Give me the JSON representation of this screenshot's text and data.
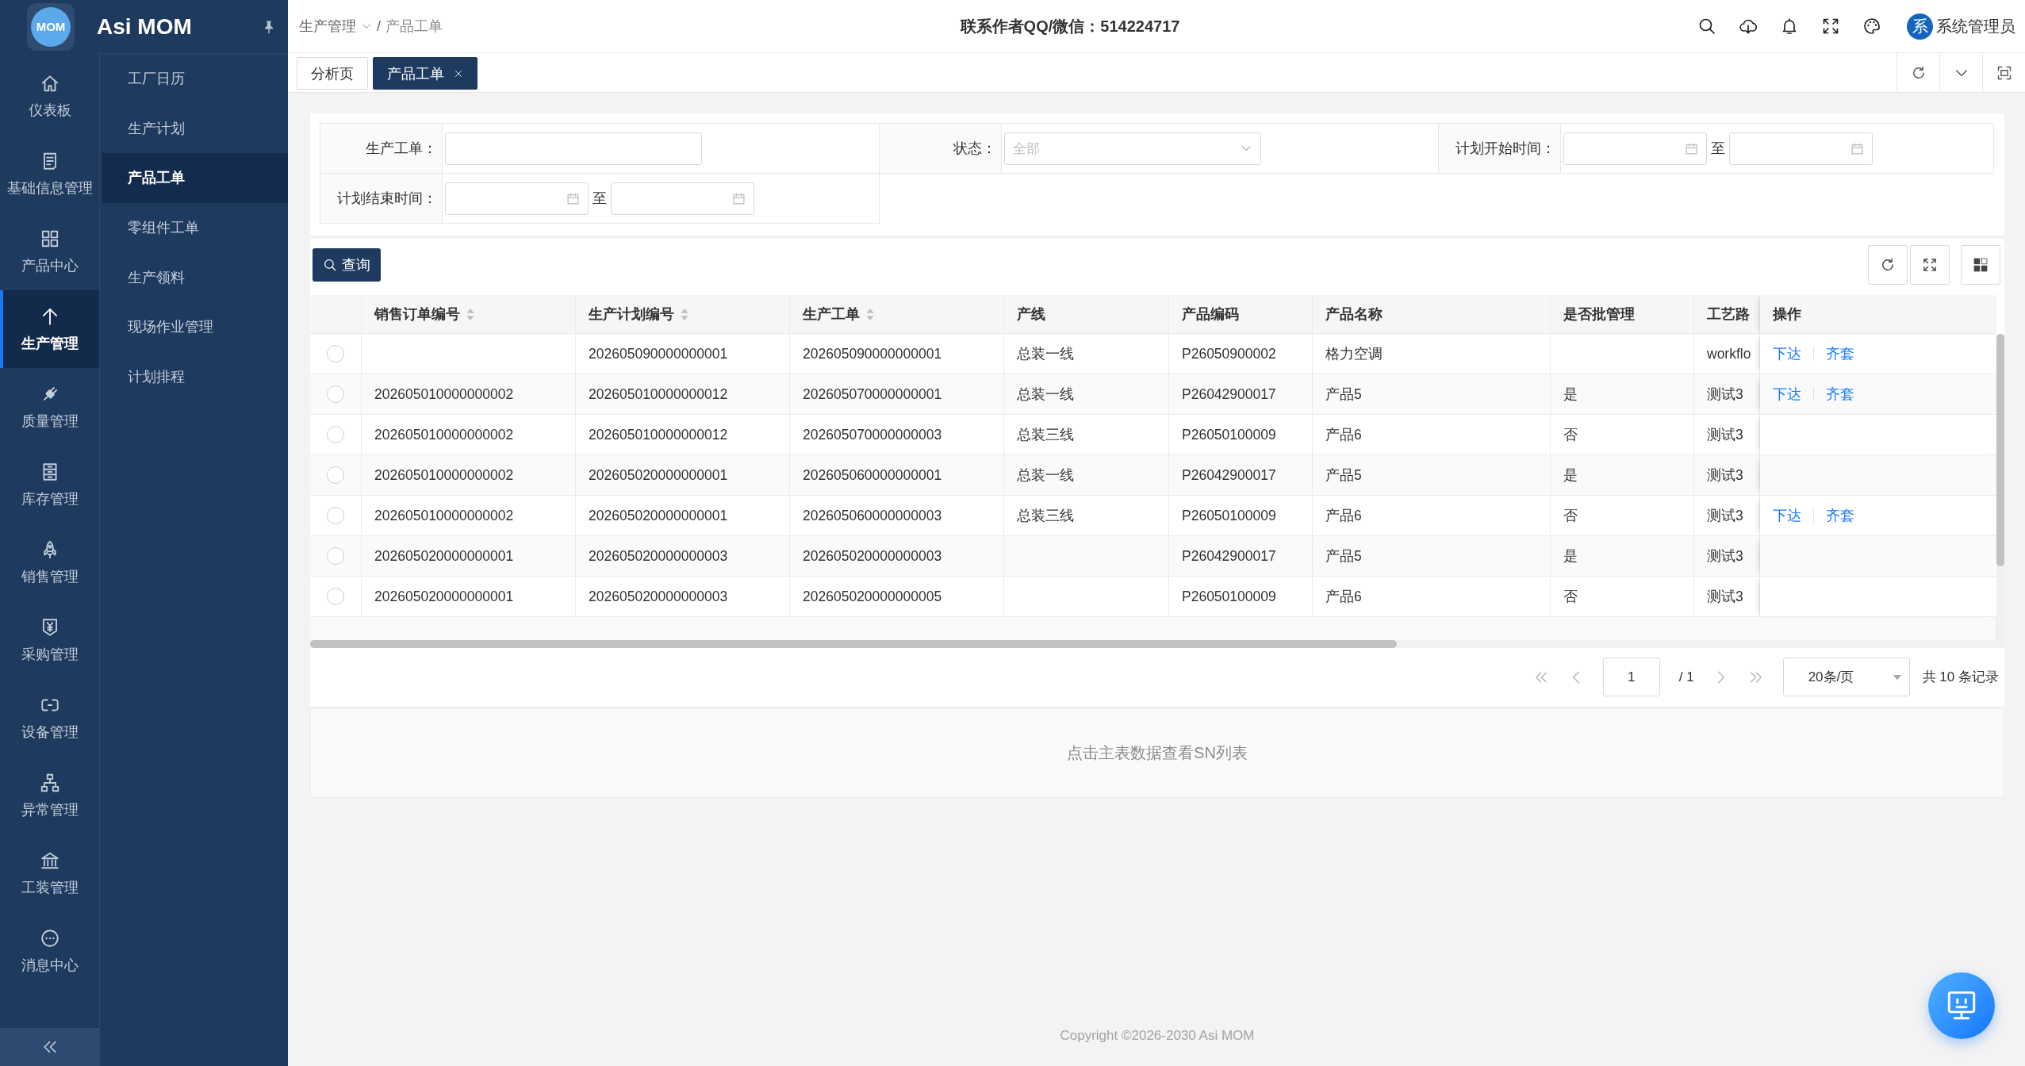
{
  "sidebar": {
    "logo_text": "MOM",
    "title": "Asi MOM",
    "items": [
      {
        "label": "仪表板",
        "selected": false
      },
      {
        "label": "基础信息管理",
        "selected": false
      },
      {
        "label": "产品中心",
        "selected": false
      },
      {
        "label": "生产管理",
        "selected": true
      },
      {
        "label": "质量管理",
        "selected": false
      },
      {
        "label": "库存管理",
        "selected": false
      },
      {
        "label": "销售管理",
        "selected": false
      },
      {
        "label": "采购管理",
        "selected": false
      },
      {
        "label": "设备管理",
        "selected": false
      },
      {
        "label": "异常管理",
        "selected": false
      },
      {
        "label": "工装管理",
        "selected": false
      },
      {
        "label": "消息中心",
        "selected": false
      }
    ]
  },
  "submenu": {
    "items": [
      {
        "label": "工厂日历",
        "selected": false
      },
      {
        "label": "生产计划",
        "selected": false
      },
      {
        "label": "产品工单",
        "selected": true
      },
      {
        "label": "零组件工单",
        "selected": false
      },
      {
        "label": "生产领料",
        "selected": false
      },
      {
        "label": "现场作业管理",
        "selected": false
      },
      {
        "label": "计划排程",
        "selected": false
      }
    ]
  },
  "header": {
    "breadcrumb": [
      {
        "label": "生产管理",
        "dropdown": true
      },
      {
        "label": "产品工单",
        "dropdown": false
      }
    ],
    "breadcrumb_separator": "/",
    "contact": "联系作者QQ/微信：514224717",
    "user": {
      "avatar": "系",
      "name": "系统管理员"
    }
  },
  "tabs": [
    {
      "label": "分析页",
      "selected": false,
      "closable": false
    },
    {
      "label": "产品工单",
      "selected": true,
      "closable": true
    }
  ],
  "filters": [
    {
      "kind": "text",
      "label": "生产工单："
    },
    {
      "kind": "select",
      "label": "状态：",
      "placeholder": "全部"
    },
    {
      "kind": "date_range",
      "label": "计划开始时间：",
      "separator": "至"
    },
    {
      "kind": "date_range",
      "label": "计划结束时间：",
      "separator": "至"
    }
  ],
  "query_button": "查询",
  "table": {
    "columns": [
      {
        "label": "销售订单编号",
        "sortable": true
      },
      {
        "label": "生产计划编号",
        "sortable": true
      },
      {
        "label": "生产工单",
        "sortable": true
      },
      {
        "label": "产线",
        "sortable": false
      },
      {
        "label": "产品编码",
        "sortable": false
      },
      {
        "label": "产品名称",
        "sortable": false
      },
      {
        "label": "是否批管理",
        "sortable": false
      },
      {
        "label": "工艺路",
        "sortable": false
      },
      {
        "label": "操作",
        "sortable": false
      }
    ],
    "rows": [
      {
        "selected": false,
        "production_plan": "202605090000000001",
        "work_order": "202605090000000001",
        "line": "总装一线",
        "product_code": "P26050900002",
        "product_name": "格力空调",
        "column_8": "workflo",
        "actions": [
          "下达",
          "齐套"
        ]
      },
      {
        "selected": false,
        "sales_order": "202605010000000002",
        "production_plan": "202605010000000012",
        "work_order": "202605070000000001",
        "line": "总装一线",
        "product_code": "P26042900017",
        "product_name": "产品5",
        "batch_managed": "是",
        "column_8": "测试3",
        "actions": [
          "下达",
          "齐套"
        ]
      },
      {
        "selected": false,
        "sales_order": "202605010000000002",
        "production_plan": "202605010000000012",
        "work_order": "202605070000000003",
        "line": "总装三线",
        "product_code": "P26050100009",
        "product_name": "产品6",
        "batch_managed": "否",
        "column_8": "测试3"
      },
      {
        "selected": false,
        "sales_order": "202605010000000002",
        "production_plan": "202605020000000001",
        "work_order": "202605060000000001",
        "line": "总装一线",
        "product_code": "P26042900017",
        "product_name": "产品5",
        "batch_managed": "是",
        "column_8": "测试3"
      },
      {
        "selected": false,
        "sales_order": "202605010000000002",
        "production_plan": "202605020000000001",
        "work_order": "202605060000000003",
        "line": "总装三线",
        "product_code": "P26050100009",
        "product_name": "产品6",
        "batch_managed": "否",
        "column_8": "测试3",
        "actions": [
          "下达",
          "齐套"
        ]
      },
      {
        "selected": false,
        "sales_order": "202605020000000001",
        "production_plan": "202605020000000003",
        "work_order": "202605020000000003",
        "product_code": "P26042900017",
        "product_name": "产品5",
        "batch_managed": "是",
        "column_8": "测试3"
      },
      {
        "selected": false,
        "sales_order": "202605020000000001",
        "production_plan": "202605020000000003",
        "work_order": "202605020000000005",
        "product_code": "P26050100009",
        "product_name": "产品6",
        "batch_managed": "否",
        "column_8": "测试3"
      }
    ]
  },
  "pagination": {
    "page": "1",
    "page_count": "/ 1",
    "page_size": "20条/页",
    "total": "共 10 条记录"
  },
  "detail_hint": "点击主表数据查看SN列表",
  "footer": "Copyright ©2026-2030 Asi MOM"
}
